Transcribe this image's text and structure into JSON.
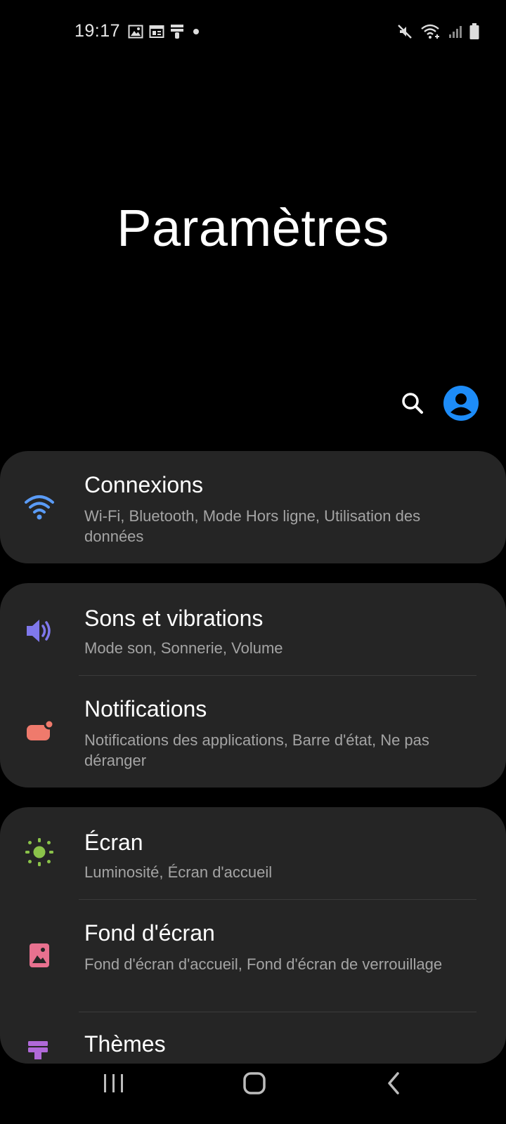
{
  "status": {
    "time": "19:17",
    "left_icons": [
      "gallery-icon",
      "calendar-widget-icon",
      "theme-brush-icon",
      "dot-icon"
    ],
    "right_icons": [
      "mute-icon",
      "wifi-call-icon",
      "signal-icon",
      "battery-icon"
    ]
  },
  "page": {
    "title": "Paramètres"
  },
  "header": {
    "search_icon": "search-icon",
    "account_icon": "account-icon"
  },
  "settings": {
    "connexions": {
      "title": "Connexions",
      "subtitle": "Wi-Fi, Bluetooth, Mode Hors ligne, Utilisation des données",
      "icon": "wifi-icon",
      "color": "#5a9bf6"
    },
    "sons": {
      "title": "Sons et vibrations",
      "subtitle": "Mode son, Sonnerie, Volume",
      "icon": "speaker-icon",
      "color": "#7f78ec"
    },
    "notifications": {
      "title": "Notifications",
      "subtitle": "Notifications des applications, Barre d'état, Ne pas déranger",
      "icon": "notification-icon",
      "color": "#ef7a6c"
    },
    "ecran": {
      "title": "Écran",
      "subtitle": "Luminosité, Écran d'accueil",
      "icon": "brightness-icon",
      "color": "#8bc34a"
    },
    "fond": {
      "title": "Fond d'écran",
      "subtitle": "Fond d'écran d'accueil, Fond d'écran de verrouillage",
      "icon": "wallpaper-icon",
      "color": "#e8718f"
    },
    "themes": {
      "title": "Thèmes",
      "subtitle": "",
      "icon": "themes-icon",
      "color": "#b069d8"
    }
  },
  "navigation": {
    "recent": "recent-apps-icon",
    "home": "home-icon",
    "back": "back-icon"
  }
}
